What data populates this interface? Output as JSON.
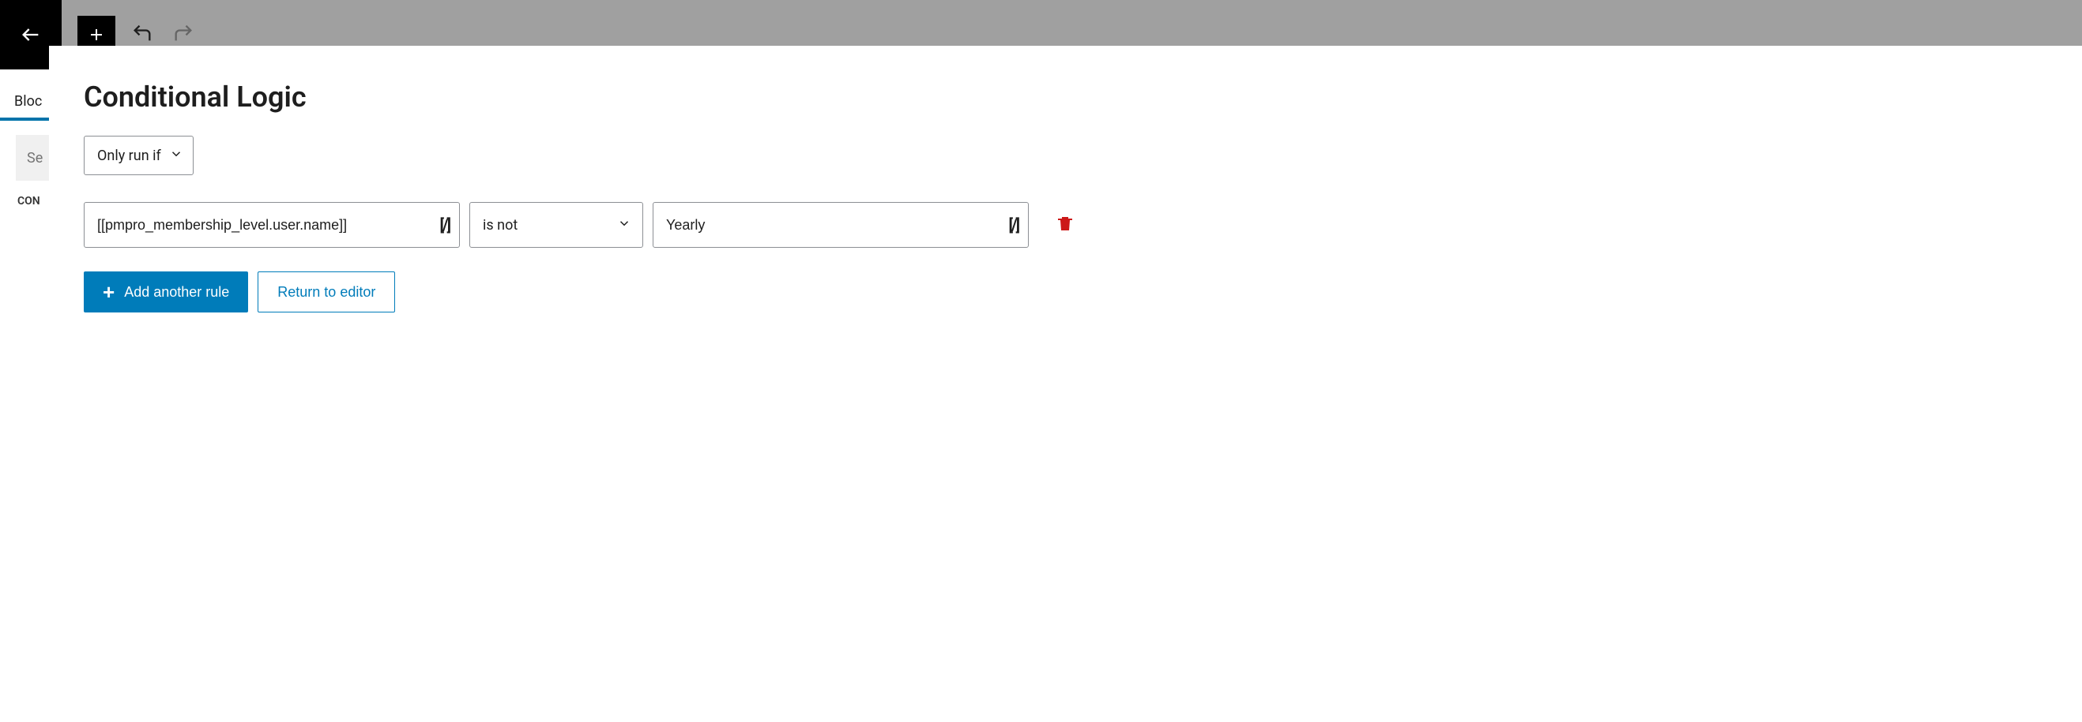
{
  "backdrop": {
    "tab_label": "Bloc",
    "search_stub": "Se",
    "con_label": "CON"
  },
  "modal": {
    "title": "Conditional Logic",
    "run_mode": "Only run if",
    "rule": {
      "field_value": "[[pmpro_membership_level.user.name]]",
      "operator": "is not",
      "compare_value": "Yearly"
    },
    "buttons": {
      "add_rule": "Add another rule",
      "return": "Return to editor"
    }
  }
}
